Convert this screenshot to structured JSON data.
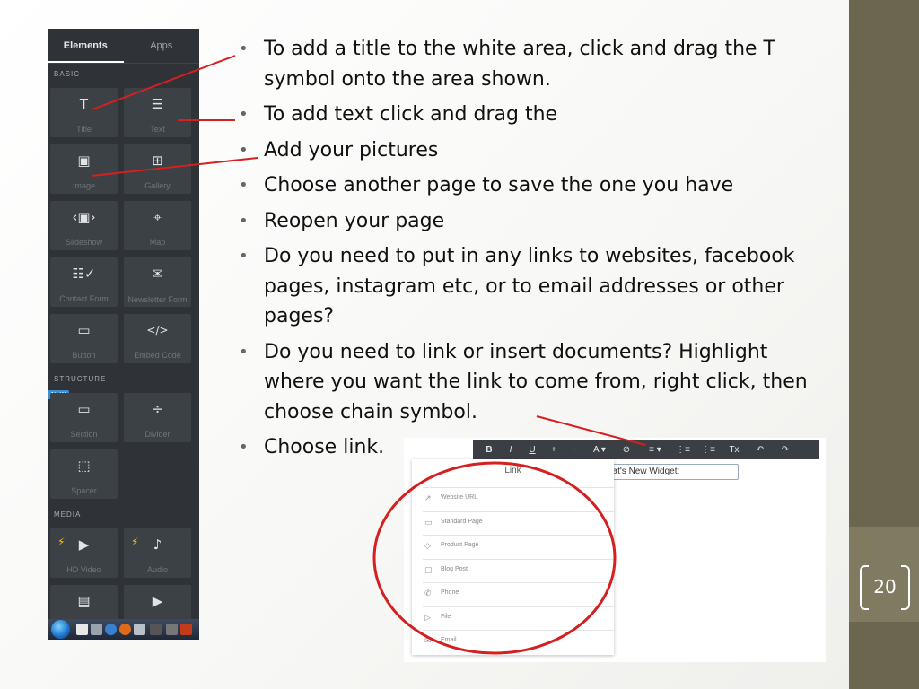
{
  "slide": {
    "page_number": "20",
    "bullets": [
      "To add a title to the white area, click and drag the T symbol onto the area shown.",
      "To add text click and drag the",
      "Add your pictures",
      "Choose another page to save the one you have",
      "Reopen your page",
      "Do you need to put in any links to websites, facebook pages, instagram etc, or to email addresses or other pages?",
      "Do you need to link or insert documents? Highlight where you want the link to come from, right click, then choose chain symbol.",
      "Choose link."
    ],
    "bullet_symbol": "•"
  },
  "editor_panel": {
    "tabs": [
      {
        "label": "Elements"
      },
      {
        "label": "Apps"
      }
    ],
    "sections": {
      "basic": "BASIC",
      "structure": "STRUCTURE",
      "media": "MEDIA"
    },
    "new_badge": "NeW",
    "tiles": {
      "title": {
        "label": "Title",
        "icon": "T"
      },
      "text": {
        "label": "Text",
        "icon": "☰"
      },
      "image": {
        "label": "Image",
        "icon": "▣"
      },
      "gallery": {
        "label": "Gallery",
        "icon": "⊞"
      },
      "slideshow": {
        "label": "Slideshow",
        "icon": "‹▣›"
      },
      "map": {
        "label": "Map",
        "icon": "⌖"
      },
      "contact_form": {
        "label": "Contact Form",
        "icon": "☷✓"
      },
      "newsletter_form": {
        "label": "Newsletter Form",
        "icon": "✉"
      },
      "button": {
        "label": "Button",
        "icon": "▭"
      },
      "embed_code": {
        "label": "Embed Code",
        "icon": "</>"
      },
      "section": {
        "label": "Section",
        "icon": "▭"
      },
      "divider": {
        "label": "Divider",
        "icon": "÷"
      },
      "spacer": {
        "label": "Spacer",
        "icon": "⬚"
      },
      "hd_video": {
        "label": "HD Video",
        "icon": "▶"
      },
      "audio": {
        "label": "Audio",
        "icon": "♪"
      },
      "document": {
        "label": "",
        "icon": "▤"
      },
      "video": {
        "label": "",
        "icon": "▶"
      }
    }
  },
  "link_dialog": {
    "toolbar": [
      "B",
      "I",
      "U",
      "+",
      "−",
      "A ▾",
      "⊘",
      "≡ ▾",
      "⋮≡",
      "⋮≡",
      "Tx",
      "↶",
      "↷"
    ],
    "widget_field_text": "hat's New Widget:",
    "title": "Link",
    "items": [
      {
        "label": "Website URL",
        "icon": "↗"
      },
      {
        "label": "Standard Page",
        "icon": "▭"
      },
      {
        "label": "Product Page",
        "icon": "◇"
      },
      {
        "label": "Blog Post",
        "icon": "▢"
      },
      {
        "label": "Phone",
        "icon": "✆"
      },
      {
        "label": "File",
        "icon": "▷"
      },
      {
        "label": "Email",
        "icon": "✉"
      }
    ]
  },
  "colors": {
    "panel_bg": "#2f3337",
    "tile_bg": "#3c4145",
    "annotation_red": "#d42020",
    "side_bar": "#6b6650"
  }
}
